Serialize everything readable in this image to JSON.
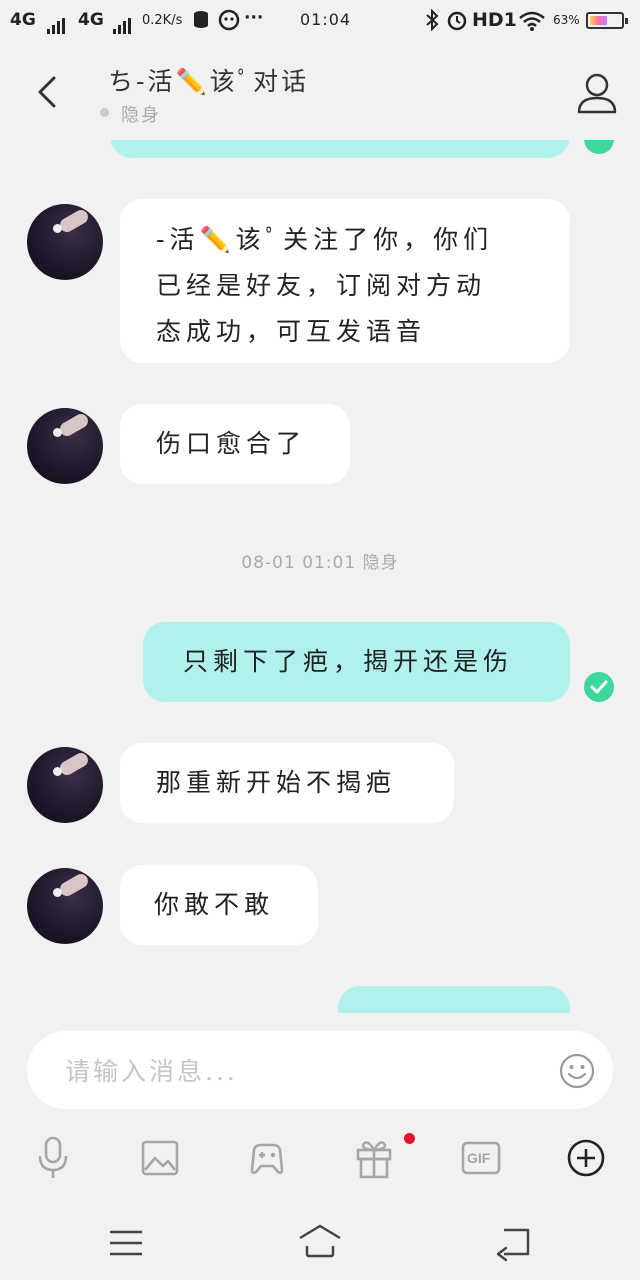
{
  "status_bar": {
    "network1": "4G",
    "network2": "4G",
    "speed": "0.2K/s",
    "dots": "···",
    "time": "01:04",
    "hd_label": "HD1",
    "battery_percent": "63%",
    "battery_level": 0.63
  },
  "header": {
    "title": "ち-活✏️该ﾟ对话",
    "status": "隐身"
  },
  "messages": [
    {
      "side": "in",
      "text_lines": [
        "-活✏️该ﾟ关注了你，你们",
        "已经是好友，订阅对方动",
        "态成功，可互发语音"
      ]
    },
    {
      "side": "in",
      "text": "伤口愈合了"
    },
    {
      "timestamp": "08-01 01:01 隐身"
    },
    {
      "side": "out",
      "text": "只剩下了疤，揭开还是伤",
      "read": true
    },
    {
      "side": "in",
      "text": "那重新开始不揭疤"
    },
    {
      "side": "in",
      "text": "你敢不敢"
    }
  ],
  "input": {
    "placeholder": "请输入消息..."
  },
  "toolbar": {
    "icons": [
      "microphone-icon",
      "image-icon",
      "gamepad-icon",
      "gift-icon",
      "gif-icon",
      "plus-circle-icon"
    ],
    "gif_label": "GIF"
  },
  "navbar": {
    "icons": [
      "menu-icon",
      "home-icon",
      "back-icon"
    ]
  },
  "colors": {
    "background": "#f1f1f1",
    "outgoing_bubble": "#b0f1ee",
    "incoming_bubble": "#ffffff",
    "read_check": "#3ed89b",
    "notification_dot": "#e8102a"
  }
}
